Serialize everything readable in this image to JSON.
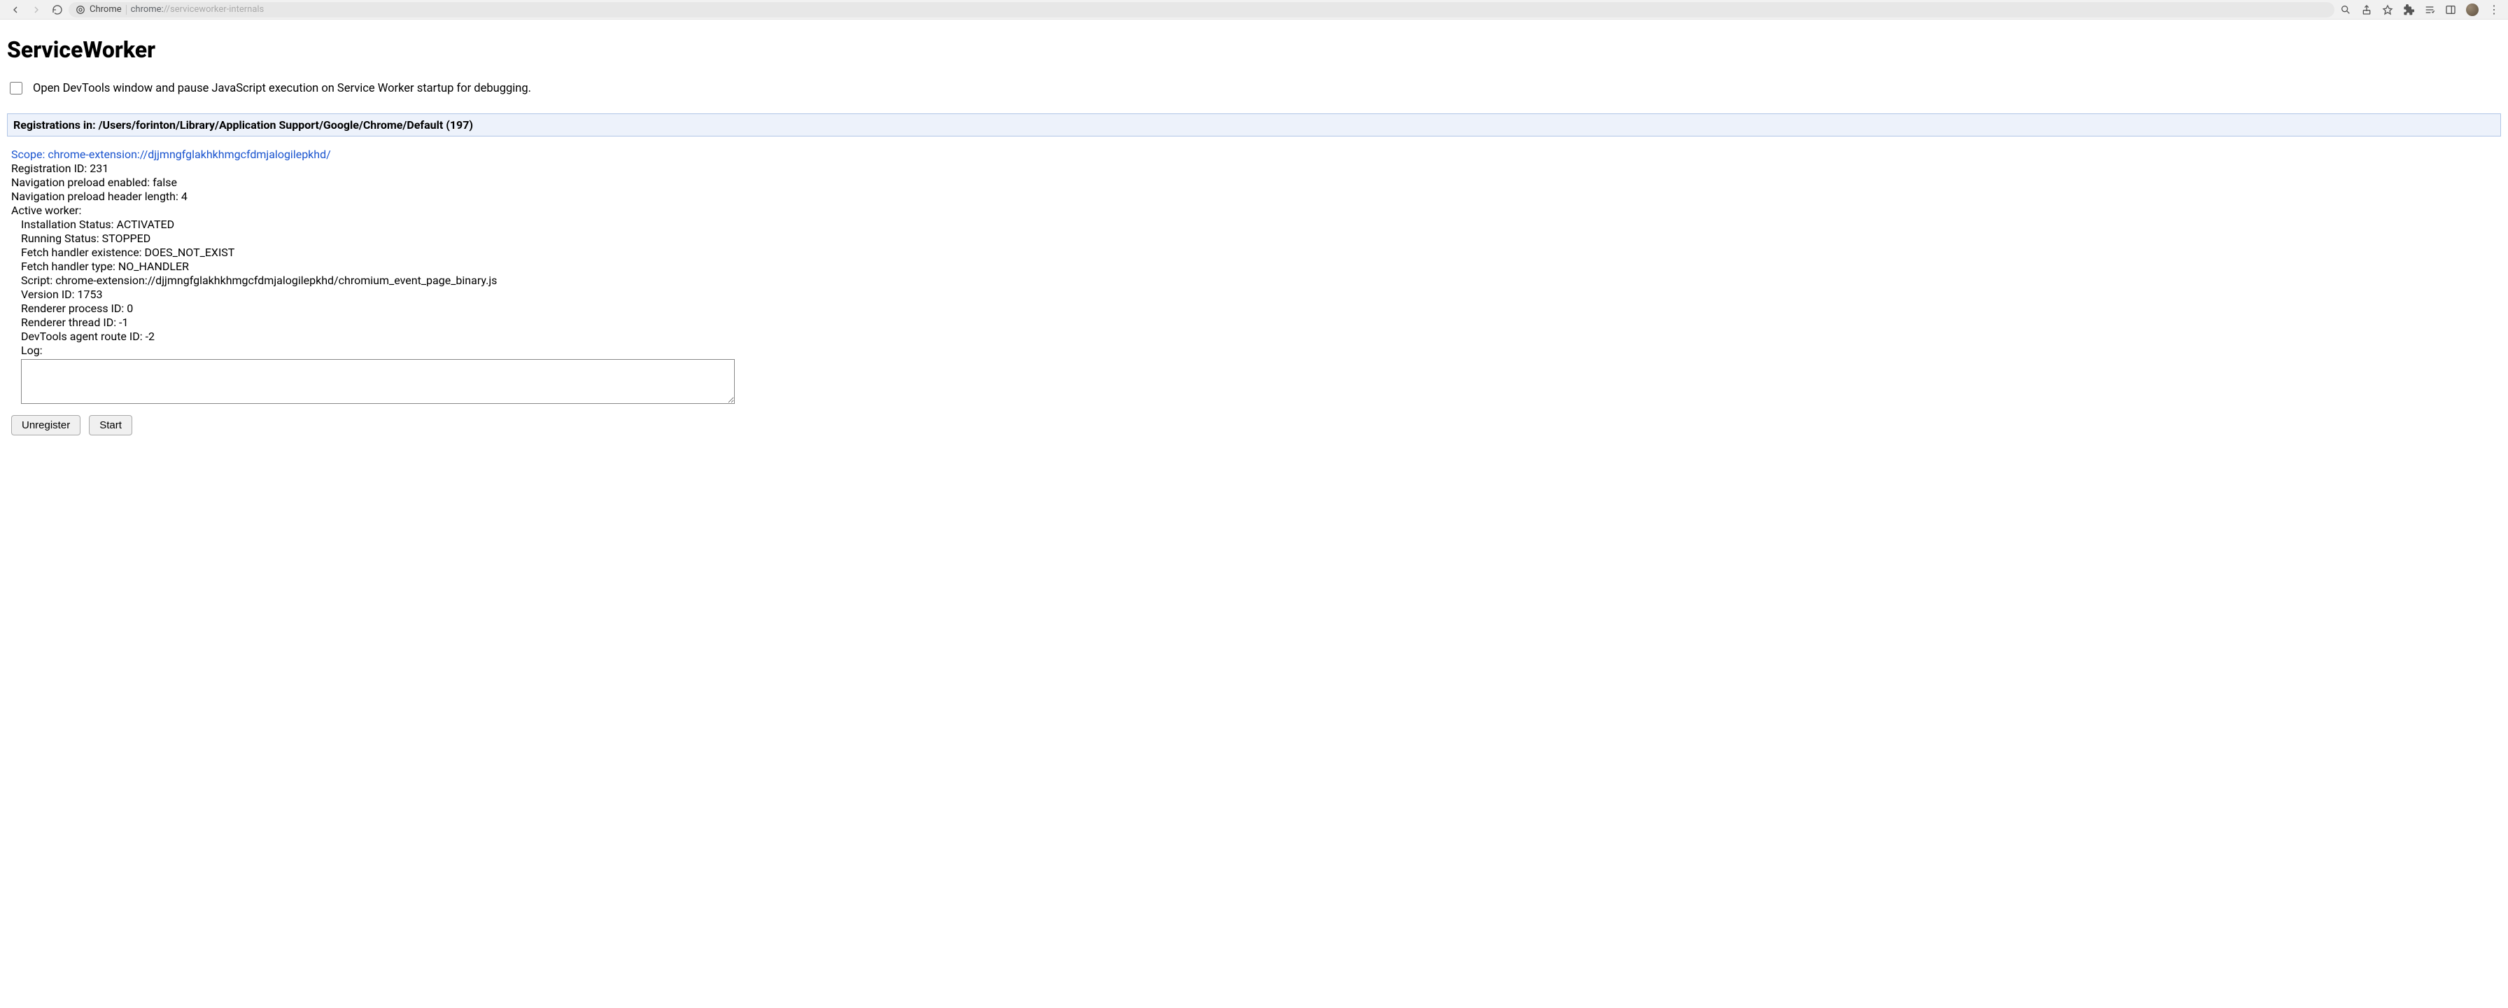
{
  "chrome": {
    "origin_label": "Chrome",
    "url_scheme": "chrome:",
    "url_rest": "//serviceworker-internals"
  },
  "page": {
    "title": "ServiceWorker",
    "devtools_checkbox_label": "Open DevTools window and pause JavaScript execution on Service Worker startup for debugging.",
    "section_header": "Registrations in: /Users/forinton/Library/Application Support/Google/Chrome/Default (197)"
  },
  "registration": {
    "scope_label": "Scope: ",
    "scope_value": "chrome-extension://djjmngfglakhkhmgcfdmjalogilepkhd/",
    "lines": {
      "registration_id_label": "Registration ID: ",
      "registration_id": "231",
      "nav_preload_enabled_label": "Navigation preload enabled: ",
      "nav_preload_enabled": "false",
      "nav_preload_header_len_label": "Navigation preload header length: ",
      "nav_preload_header_len": "4",
      "active_worker_label": "Active worker:"
    },
    "worker": {
      "installation_status_label": "Installation Status: ",
      "installation_status": "ACTIVATED",
      "running_status_label": "Running Status: ",
      "running_status": "STOPPED",
      "fetch_handler_existence_label": "Fetch handler existence: ",
      "fetch_handler_existence": "DOES_NOT_EXIST",
      "fetch_handler_type_label": "Fetch handler type: ",
      "fetch_handler_type": "NO_HANDLER",
      "script_label": "Script: ",
      "script": "chrome-extension://djjmngfglakhkhmgcfdmjalogilepkhd/chromium_event_page_binary.js",
      "version_id_label": "Version ID: ",
      "version_id": "1753",
      "renderer_process_id_label": "Renderer process ID: ",
      "renderer_process_id": "0",
      "renderer_thread_id_label": "Renderer thread ID: ",
      "renderer_thread_id": "-1",
      "devtools_route_id_label": "DevTools agent route ID: ",
      "devtools_route_id": "-2",
      "log_label": "Log:",
      "log_value": ""
    },
    "buttons": {
      "unregister": "Unregister",
      "start": "Start"
    }
  }
}
